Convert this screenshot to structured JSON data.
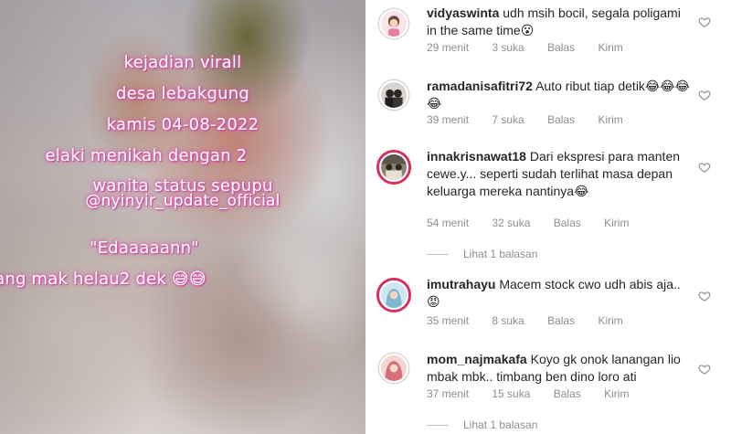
{
  "video": {
    "captions": [
      "kejadian virall",
      "desa lebakgung",
      "kamis 04-08-2022",
      "elaki menikah dengan 2",
      "wanita status sepupu",
      "@nyinyir_update_official",
      "\"Edaaaaann\"",
      "ang mak helau2 dek 😅😅"
    ]
  },
  "comments": [
    {
      "username": "vidyaswinta",
      "text": "udh msih bocil, segala poligami in the same time😮",
      "time": "29 menit",
      "likes": "3 suka",
      "reply": "Balas",
      "send": "Kirim",
      "avatar_color": "#f3c7d4"
    },
    {
      "username": "ramadanisafitri72",
      "text": "Auto ribut tiap detik😂😂😂😂",
      "time": "39 menit",
      "likes": "7 suka",
      "reply": "Balas",
      "send": "Kirim",
      "avatar_color": "#3d3a3c"
    },
    {
      "username": "innakrisnawat18",
      "text": "Dari ekspresi para manten cewe.y... seperti sudah terlihat masa depan keluarga mereka nantinya😂",
      "time": "54 menit",
      "likes": "32 suka",
      "reply": "Balas",
      "send": "Kirim",
      "avatar_color": "#7b6f5a",
      "view_replies": "Lihat 1 balasan"
    },
    {
      "username": "imutrahayu",
      "text": "Macem stock cwo udh abis aja.. 😡",
      "time": "35 menit",
      "likes": "8 suka",
      "reply": "Balas",
      "send": "Kirim",
      "avatar_color": "#a9cde0"
    },
    {
      "username": "mom_najmakafa",
      "text": "Koyo gk onok lanangan lio mbak mbk.. timbang ben dino loro ati",
      "time": "37 menit",
      "likes": "15 suka",
      "reply": "Balas",
      "send": "Kirim",
      "avatar_color": "#d88a8f",
      "view_replies": "Lihat 1 balasan"
    }
  ]
}
